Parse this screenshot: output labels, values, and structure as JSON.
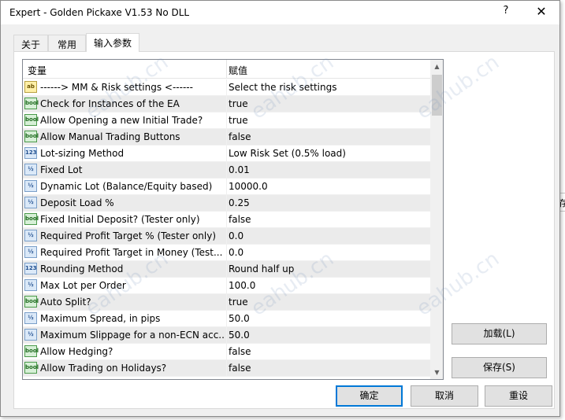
{
  "window": {
    "title": "Expert - Golden Pickaxe V1.53 No DLL",
    "help_glyph": "?",
    "close_glyph": "✕"
  },
  "tabs": [
    {
      "label": "关于"
    },
    {
      "label": "常用"
    },
    {
      "label": "输入参数"
    }
  ],
  "grid": {
    "columns": [
      "变量",
      "赋值"
    ],
    "rows": [
      {
        "icon": "ab",
        "name": "------> MM & Risk settings <------",
        "value": "Select the risk settings"
      },
      {
        "icon": "bool",
        "name": "Check for Instances of the EA",
        "value": "true"
      },
      {
        "icon": "bool",
        "name": "Allow Opening a new Initial Trade?",
        "value": "true"
      },
      {
        "icon": "bool",
        "name": "Allow Manual Trading Buttons",
        "value": "false"
      },
      {
        "icon": "123",
        "name": "Lot-sizing Method",
        "value": "Low Risk Set (0.5% load)"
      },
      {
        "icon": "½",
        "name": "Fixed Lot",
        "value": "0.01"
      },
      {
        "icon": "½",
        "name": "Dynamic Lot (Balance/Equity based)",
        "value": "10000.0"
      },
      {
        "icon": "½",
        "name": "Deposit Load %",
        "value": "0.25"
      },
      {
        "icon": "bool",
        "name": "Fixed Initial Deposit? (Tester only)",
        "value": "false"
      },
      {
        "icon": "½",
        "name": "Required Profit Target % (Tester only)",
        "value": "0.0"
      },
      {
        "icon": "½",
        "name": "Required Profit Target in Money (Test...",
        "value": "0.0"
      },
      {
        "icon": "123",
        "name": "Rounding Method",
        "value": "Round half up"
      },
      {
        "icon": "½",
        "name": "Max Lot per Order",
        "value": "100.0"
      },
      {
        "icon": "bool",
        "name": "Auto Split?",
        "value": "true"
      },
      {
        "icon": "½",
        "name": "Maximum Spread, in pips",
        "value": "50.0"
      },
      {
        "icon": "½",
        "name": "Maximum Slippage for a non-ECN acc...",
        "value": "50.0"
      },
      {
        "icon": "bool",
        "name": "Allow Hedging?",
        "value": "false"
      },
      {
        "icon": "bool",
        "name": "Allow Trading on Holidays?",
        "value": "false"
      }
    ]
  },
  "side_buttons": {
    "load": "加载(L)",
    "save": "保存(S)"
  },
  "bottom_buttons": {
    "ok": "确定",
    "cancel": "取消",
    "reset": "重设"
  },
  "background": {
    "edge_text": "存"
  },
  "watermark_text": "eahub.cn"
}
